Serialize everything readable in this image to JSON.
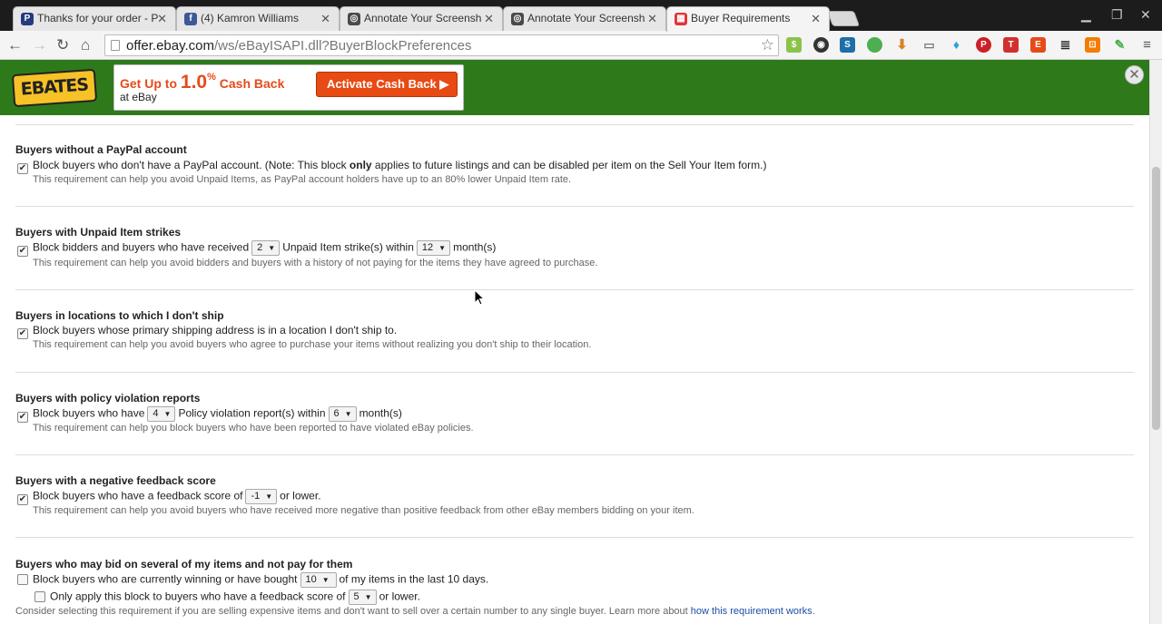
{
  "browser": {
    "tabs": [
      {
        "title": "Thanks for your order - P",
        "icon": "paypal-icon",
        "color": "#253b80",
        "glyph": "P"
      },
      {
        "title": "(4) Kamron Williams",
        "icon": "facebook-icon",
        "color": "#3b5998",
        "glyph": "f"
      },
      {
        "title": "Annotate Your Screensh",
        "icon": "chrome-page-icon",
        "color": "#4a4a4a",
        "glyph": "◎"
      },
      {
        "title": "Annotate Your Screensh",
        "icon": "chrome-page-icon",
        "color": "#4a4a4a",
        "glyph": "◎"
      },
      {
        "title": "Buyer Requirements",
        "icon": "ebay-icon",
        "color": "#e53238",
        "glyph": "▦",
        "active": true
      }
    ],
    "url": {
      "host": "offer.ebay.com",
      "path": "/ws/eBayISAPI.dll?BuyerBlockPreferences"
    }
  },
  "ebates": {
    "logo": "EBATES",
    "offer_prefix": "Get Up to ",
    "offer_rate": "1.0",
    "offer_pct": "%",
    "offer_suffix": " Cash Back",
    "store": "at eBay",
    "button": "Activate Cash Back ▶",
    "colors": {
      "bar": "#2e7a1b",
      "accent": "#e84a14"
    }
  },
  "sections": {
    "paypal": {
      "title": "Buyers without a PayPal account",
      "checked": true,
      "text_a": "Block buyers who don't have a PayPal account. (Note: This block ",
      "text_bold": "only",
      "text_b": " applies to future listings and can be disabled per item on the Sell Your Item form.)",
      "note": "This requirement can help you avoid Unpaid Items, as PayPal account holders have up to an 80% lower Unpaid Item rate."
    },
    "unpaid": {
      "title": "Buyers with Unpaid Item strikes",
      "checked": true,
      "text_a": "Block bidders and buyers who have received",
      "strikes": "2",
      "text_b": "Unpaid Item strike(s) within",
      "months": "12",
      "text_c": "month(s)",
      "note": "This requirement can help you avoid bidders and buyers with a history of not paying for the items they have agreed to purchase."
    },
    "location": {
      "title": "Buyers in locations to which I don't ship",
      "checked": true,
      "text_a": "Block buyers whose primary shipping address is in a location I don't ship to.",
      "note": "This requirement can help you avoid buyers who agree to purchase your items without realizing you don't ship to their location."
    },
    "policy": {
      "title": "Buyers with policy violation reports",
      "checked": true,
      "text_a": "Block buyers who have",
      "reports": "4",
      "text_b": "Policy violation report(s) within",
      "months": "6",
      "text_c": "month(s)",
      "note": "This requirement can help you block buyers who have been reported to have violated eBay policies."
    },
    "feedback": {
      "title": "Buyers with a negative feedback score",
      "checked": true,
      "text_a": "Block buyers who have a feedback score of",
      "score": "-1",
      "text_b": "or lower.",
      "note": "This requirement can help you avoid buyers who have received more negative than positive feedback from other eBay members bidding on your item."
    },
    "several": {
      "title": "Buyers who may bid on several of my items and not pay for them",
      "checked": false,
      "text_a": "Block buyers who are currently winning or have bought",
      "count": "10",
      "text_b": "of my items in the last 10 days.",
      "sub_checked": false,
      "sub_text_a": "Only apply this block to buyers who have a feedback score of",
      "sub_score": "5",
      "sub_text_b": "or lower.",
      "note_a": "Consider selecting this requirement if you are selling expensive items and don't want to sell over a certain number to any single buyer. Learn more about ",
      "note_link": "how this requirement works",
      "note_b": "."
    }
  }
}
